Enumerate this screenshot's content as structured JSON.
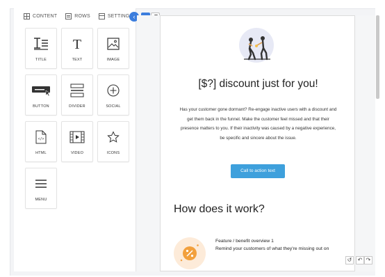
{
  "tabs": [
    {
      "label": "CONTENT",
      "icon": "grid-icon",
      "active": true
    },
    {
      "label": "ROWS",
      "icon": "rows-icon",
      "active": false
    },
    {
      "label": "SETTINGS",
      "icon": "settings-icon",
      "active": false
    }
  ],
  "colors": {
    "accent": "#3b7ddd",
    "cta": "#3ea0dc",
    "badge": "#fdebd9",
    "badge_icon": "#f2a03d"
  },
  "tiles": [
    {
      "label": "TITLE",
      "icon": "title-icon"
    },
    {
      "label": "TEXT",
      "icon": "text-icon"
    },
    {
      "label": "IMAGE",
      "icon": "image-icon"
    },
    {
      "label": "BUTTON",
      "icon": "button-icon"
    },
    {
      "label": "DIVIDER",
      "icon": "divider-icon"
    },
    {
      "label": "SOCIAL",
      "icon": "social-icon"
    },
    {
      "label": "HTML",
      "icon": "html-icon"
    },
    {
      "label": "VIDEO",
      "icon": "video-icon"
    },
    {
      "label": "ICONS",
      "icon": "star-icon"
    },
    {
      "label": "MENU",
      "icon": "menu-icon"
    }
  ],
  "email": {
    "headline": "[$?] discount just for you!",
    "body": "Has your customer gone dormant? Re-engage inactive users with a discount and get them back in the funnel. Make the customer feel missed and that their presence matters to you. If their inactivity was caused by a negative experience, be specific and sincere about the issue.",
    "cta_label": "Call to action text",
    "section_title": "How does it work?",
    "feature_title": "Feature / benefit overview 1",
    "feature_desc": "Remind your customers of what they're missing out on"
  },
  "history": [
    "history-icon",
    "undo-icon",
    "redo-icon"
  ]
}
